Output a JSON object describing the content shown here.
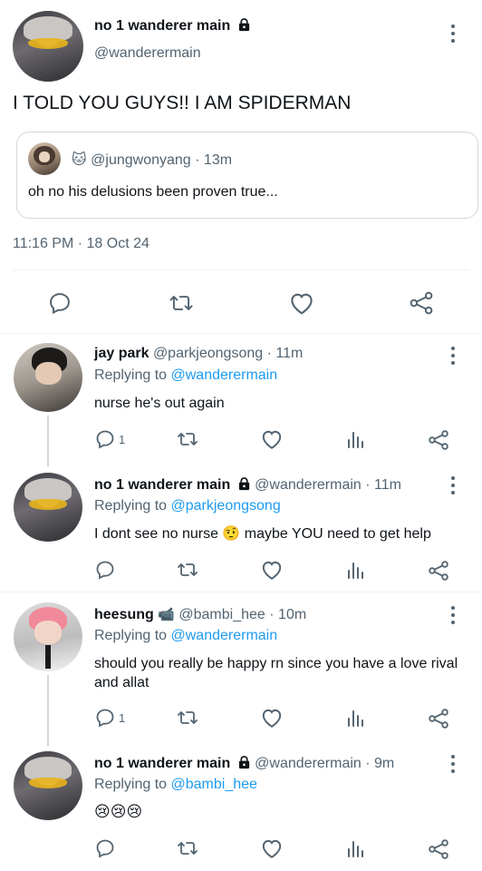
{
  "main_tweet": {
    "name": "no 1 wanderer main",
    "handle": "@wanderermain",
    "text": "I TOLD YOU GUYS!! I AM SPIDERMAN",
    "quote": {
      "emoji": "🐱",
      "handle": "@jungwonyang",
      "time": "· 13m",
      "text": "oh no his delusions been proven true..."
    },
    "timestamp": "11:16 PM · 18 Oct 24",
    "icons": [
      "reply-icon",
      "retweet-icon",
      "like-icon",
      "share-icon"
    ]
  },
  "replies": [
    {
      "name": "jay park",
      "handle": "@parkjeongsong",
      "time": "· 11m",
      "replying_prefix": "Replying to ",
      "replying_to": "@wanderermain",
      "text": "nurse he's out again",
      "reply_count": "1"
    },
    {
      "name": "no 1 wanderer main",
      "handle": "@wanderermain",
      "time": "· 11m",
      "replying_prefix": "Replying to ",
      "replying_to": "@parkjeongsong",
      "text": "I dont see no nurse 🤨 maybe YOU need to get help",
      "reply_count": ""
    },
    {
      "name": "heesung",
      "name_emoji": "📹",
      "handle": "@bambi_hee",
      "time": "· 10m",
      "replying_prefix": "Replying to ",
      "replying_to": "@wanderermain",
      "text": "should you really be happy rn since you have a love rival and allat",
      "reply_count": "1"
    },
    {
      "name": "no 1 wanderer main",
      "handle": "@wanderermain",
      "time": "· 9m",
      "replying_prefix": "Replying to ",
      "replying_to": "@bambi_hee",
      "text": "😢😢😢",
      "reply_count": ""
    }
  ],
  "colors": {
    "text": "#0f1419",
    "secondary": "#536471",
    "link": "#1d9bf0",
    "divider": "#eff3f4"
  }
}
